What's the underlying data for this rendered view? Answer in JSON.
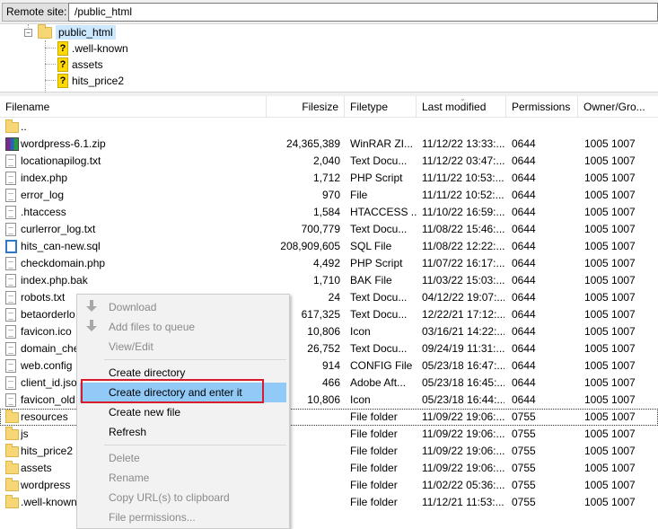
{
  "site_bar": {
    "label": "Remote site:",
    "path": "/public_html"
  },
  "tree": {
    "root": "public_html",
    "children": [
      ".well-known",
      "assets",
      "hits_price2"
    ]
  },
  "columns": [
    "Filename",
    "Filesize",
    "Filetype",
    "Last modified",
    "Permissions",
    "Owner/Gro..."
  ],
  "files": [
    {
      "icon": "folder",
      "name": "..",
      "size": "",
      "type": "",
      "modified": "",
      "perm": "",
      "owner": ""
    },
    {
      "icon": "zip",
      "name": "wordpress-6.1.zip",
      "size": "24,365,389",
      "type": "WinRAR ZI...",
      "modified": "11/12/22 13:33:...",
      "perm": "0644",
      "owner": "1005 1007"
    },
    {
      "icon": "file",
      "name": "locationapilog.txt",
      "size": "2,040",
      "type": "Text Docu...",
      "modified": "11/12/22 03:47:...",
      "perm": "0644",
      "owner": "1005 1007"
    },
    {
      "icon": "file",
      "name": "index.php",
      "size": "1,712",
      "type": "PHP Script",
      "modified": "11/11/22 10:53:...",
      "perm": "0644",
      "owner": "1005 1007"
    },
    {
      "icon": "file",
      "name": "error_log",
      "size": "970",
      "type": "File",
      "modified": "11/11/22 10:52:...",
      "perm": "0644",
      "owner": "1005 1007"
    },
    {
      "icon": "file",
      "name": ".htaccess",
      "size": "1,584",
      "type": "HTACCESS ...",
      "modified": "11/10/22 16:59:...",
      "perm": "0644",
      "owner": "1005 1007"
    },
    {
      "icon": "file",
      "name": "curlerror_log.txt",
      "size": "700,779",
      "type": "Text Docu...",
      "modified": "11/08/22 15:46:...",
      "perm": "0644",
      "owner": "1005 1007"
    },
    {
      "icon": "sql",
      "name": "hits_can-new.sql",
      "size": "208,909,605",
      "type": "SQL File",
      "modified": "11/08/22 12:22:...",
      "perm": "0644",
      "owner": "1005 1007"
    },
    {
      "icon": "file",
      "name": "checkdomain.php",
      "size": "4,492",
      "type": "PHP Script",
      "modified": "11/07/22 16:17:...",
      "perm": "0644",
      "owner": "1005 1007"
    },
    {
      "icon": "file",
      "name": "index.php.bak",
      "size": "1,710",
      "type": "BAK File",
      "modified": "11/03/22 15:03:...",
      "perm": "0644",
      "owner": "1005 1007"
    },
    {
      "icon": "file",
      "name": "robots.txt",
      "size": "24",
      "type": "Text Docu...",
      "modified": "04/12/22 19:07:...",
      "perm": "0644",
      "owner": "1005 1007"
    },
    {
      "icon": "file",
      "name": "betaorderlo",
      "size": "617,325",
      "type": "Text Docu...",
      "modified": "12/22/21 17:12:...",
      "perm": "0644",
      "owner": "1005 1007"
    },
    {
      "icon": "file",
      "name": "favicon.ico",
      "size": "10,806",
      "type": "Icon",
      "modified": "03/16/21 14:22:...",
      "perm": "0644",
      "owner": "1005 1007"
    },
    {
      "icon": "file",
      "name": "domain_che",
      "size": "26,752",
      "type": "Text Docu...",
      "modified": "09/24/19 11:31:...",
      "perm": "0644",
      "owner": "1005 1007"
    },
    {
      "icon": "file",
      "name": "web.config",
      "size": "914",
      "type": "CONFIG File",
      "modified": "05/23/18 16:47:...",
      "perm": "0644",
      "owner": "1005 1007"
    },
    {
      "icon": "file",
      "name": "client_id.jso",
      "size": "466",
      "type": "Adobe Aft...",
      "modified": "05/23/18 16:45:...",
      "perm": "0644",
      "owner": "1005 1007"
    },
    {
      "icon": "file",
      "name": "favicon_old",
      "size": "10,806",
      "type": "Icon",
      "modified": "05/23/18 16:44:...",
      "perm": "0644",
      "owner": "1005 1007"
    },
    {
      "icon": "folder",
      "name": "resources",
      "size": "",
      "type": "File folder",
      "modified": "11/09/22 19:06:...",
      "perm": "0755",
      "owner": "1005 1007"
    },
    {
      "icon": "folder",
      "name": "js",
      "size": "",
      "type": "File folder",
      "modified": "11/09/22 19:06:...",
      "perm": "0755",
      "owner": "1005 1007"
    },
    {
      "icon": "folder",
      "name": "hits_price2",
      "size": "",
      "type": "File folder",
      "modified": "11/09/22 19:06:...",
      "perm": "0755",
      "owner": "1005 1007"
    },
    {
      "icon": "folder",
      "name": "assets",
      "size": "",
      "type": "File folder",
      "modified": "11/09/22 19:06:...",
      "perm": "0755",
      "owner": "1005 1007"
    },
    {
      "icon": "folder",
      "name": "wordpress",
      "size": "",
      "type": "File folder",
      "modified": "11/02/22 05:36:...",
      "perm": "0755",
      "owner": "1005 1007"
    },
    {
      "icon": "folder",
      "name": ".well-known",
      "size": "",
      "type": "File folder",
      "modified": "11/12/21 11:53:...",
      "perm": "0755",
      "owner": "1005 1007"
    }
  ],
  "context_menu": {
    "download": "Download",
    "add_to_queue": "Add files to queue",
    "view_edit": "View/Edit",
    "create_directory": "Create directory",
    "create_directory_enter": "Create directory and enter it",
    "create_new_file": "Create new file",
    "refresh": "Refresh",
    "delete": "Delete",
    "rename": "Rename",
    "copy_url": "Copy URL(s) to clipboard",
    "file_permissions": "File permissions..."
  },
  "colors": {
    "highlight": "#91c9f7",
    "annotation_box": "#d91c2b",
    "folder": "#f7d675"
  }
}
